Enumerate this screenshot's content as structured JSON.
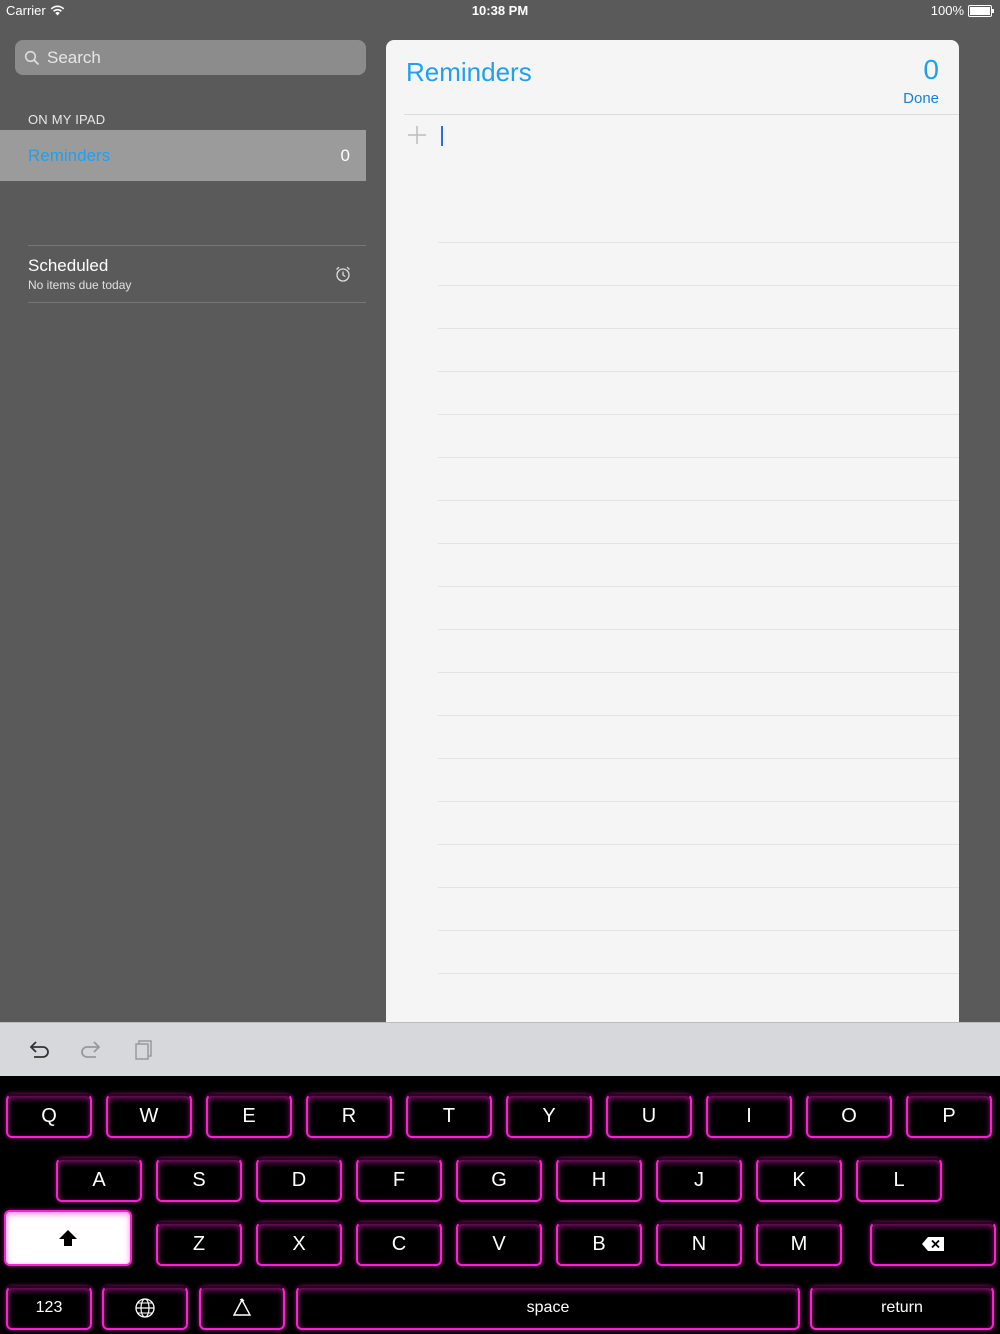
{
  "status": {
    "carrier": "Carrier",
    "time": "10:38 PM",
    "battery": "100%"
  },
  "sidebar": {
    "search_placeholder": "Search",
    "section_header": "ON MY IPAD",
    "lists": [
      {
        "name": "Reminders",
        "count": "0"
      }
    ],
    "scheduled": {
      "title": "Scheduled",
      "subtitle": "No items due today"
    }
  },
  "main": {
    "title": "Reminders",
    "count": "0",
    "done_label": "Done"
  },
  "toolbar": {
    "icons": [
      "undo-icon",
      "redo-icon",
      "paste-icon"
    ]
  },
  "keyboard": {
    "row1": [
      "Q",
      "W",
      "E",
      "R",
      "T",
      "Y",
      "U",
      "I",
      "O",
      "P"
    ],
    "row2": [
      "A",
      "S",
      "D",
      "F",
      "G",
      "H",
      "J",
      "K",
      "L"
    ],
    "row3": [
      "Z",
      "X",
      "C",
      "V",
      "B",
      "N",
      "M"
    ],
    "numbers_label": "123",
    "space_label": "space",
    "return_label": "return",
    "accent_color": "#ff1fd3"
  },
  "colors": {
    "accent": "#1fa0f0",
    "background": "#5a5a5a"
  }
}
